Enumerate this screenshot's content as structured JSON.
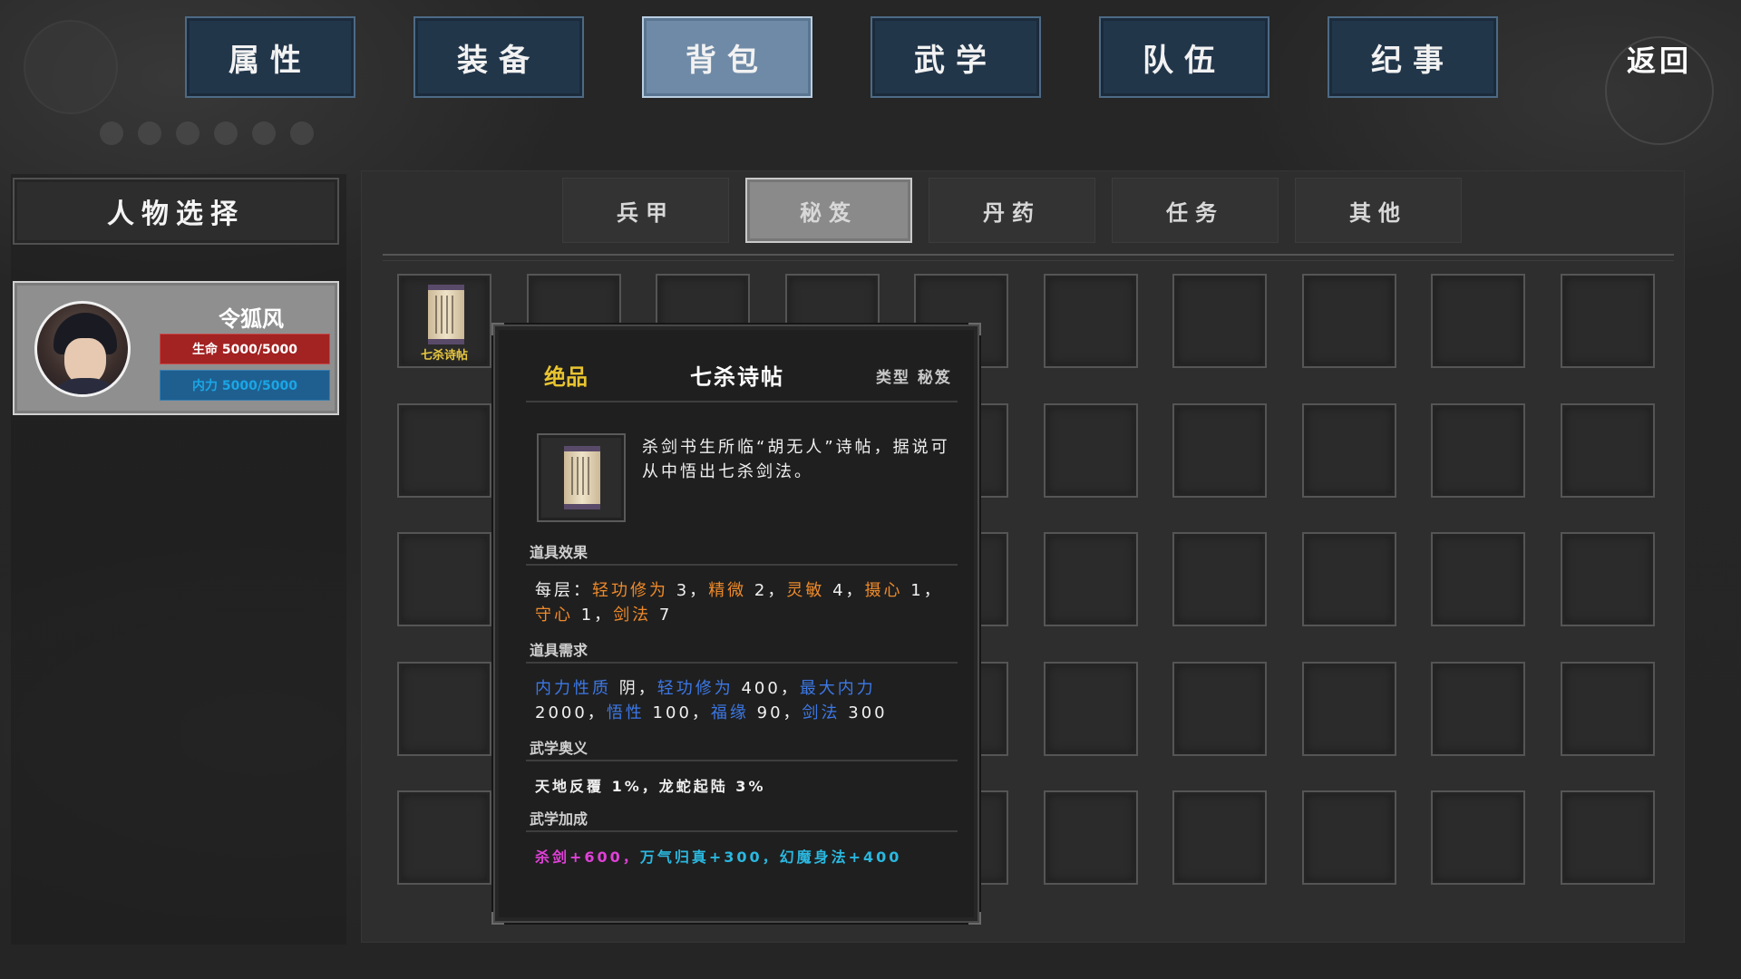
{
  "nav": {
    "tabs": [
      "属性",
      "装备",
      "背包",
      "武学",
      "队伍",
      "纪事"
    ],
    "active_tab": "背包",
    "back_label": "返回"
  },
  "left_panel": {
    "title": "人物选择",
    "character": {
      "name": "令狐风",
      "hp_label": "生命 5000/5000",
      "mp_label": "内力 5000/5000"
    }
  },
  "inventory": {
    "sub_tabs": [
      "兵甲",
      "秘笈",
      "丹药",
      "任务",
      "其他"
    ],
    "active_sub_tab": "秘笈",
    "grid": {
      "columns": 10,
      "rows": 5
    },
    "items": [
      {
        "slot": 0,
        "label": "七杀诗帖",
        "icon": "scroll-icon"
      }
    ]
  },
  "tooltip": {
    "rarity": "绝品",
    "name": "七杀诗帖",
    "type_label": "类型 秘笈",
    "description": "杀剑书生所临“胡无人”诗帖，据说可从中悟出七杀剑法。",
    "sections": {
      "effect_title": "道具效果",
      "effect_prefix": "每层：",
      "effect_1_name": "轻功修为",
      "effect_1_val": " 3，",
      "effect_2_name": "精微",
      "effect_2_val": " 2，",
      "effect_3_name": "灵敏",
      "effect_3_val": " 4，",
      "effect_4_name": "摄心",
      "effect_4_val": " 1，",
      "effect_5_name": "守心",
      "effect_5_val": " 1，",
      "effect_6_name": "剑法",
      "effect_6_val": " 7",
      "req_title": "道具需求",
      "req_1_name": "内力性质",
      "req_1_val": " 阴，",
      "req_2_name": "轻功修为",
      "req_2_val": " 400，",
      "req_3_name": "最大内力",
      "req_3_val": " 2000，",
      "req_4_name": "悟性",
      "req_4_val": " 100，",
      "req_5_name": "福缘",
      "req_5_val": " 90，",
      "req_6_name": "剑法",
      "req_6_val": " 300",
      "arcana_title": "武学奥义",
      "arcana_text": "天地反覆 1%，龙蛇起陆 3%",
      "bonus_title": "武学加成",
      "bonus_1": "杀剑+600，",
      "bonus_2": "万气归真+300，",
      "bonus_3": "幻魔身法+400"
    }
  },
  "colors": {
    "rarity": "#e8c430",
    "stat_orange": "#ee8a2a",
    "req_blue": "#3c78e6",
    "bonus_magenta": "#e040d8",
    "bonus_cyan": "#2ab8e0",
    "hp_red": "#a32222",
    "mp_blue": "#1f5f8f"
  }
}
